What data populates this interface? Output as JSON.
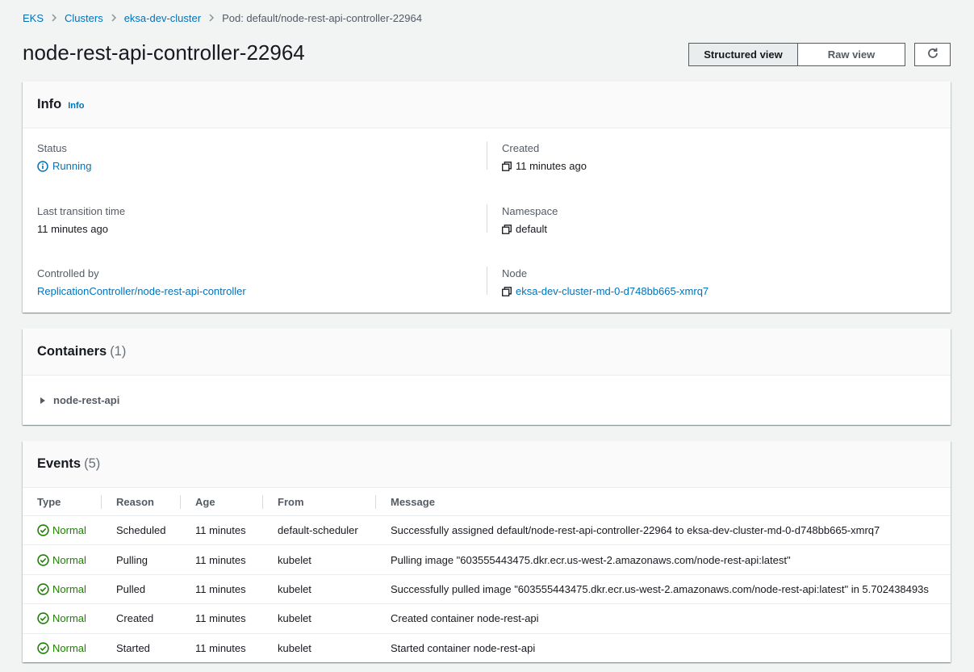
{
  "breadcrumb": {
    "items": [
      "EKS",
      "Clusters",
      "eksa-dev-cluster"
    ],
    "current": "Pod: default/node-rest-api-controller-22964"
  },
  "header": {
    "title": "node-rest-api-controller-22964",
    "structured_view": "Structured view",
    "raw_view": "Raw view",
    "refresh_icon": "refresh-icon"
  },
  "info": {
    "title": "Info",
    "info_link": "Info",
    "status_label": "Status",
    "status_value": "Running",
    "created_label": "Created",
    "created_value": "11 minutes ago",
    "last_transition_label": "Last transition time",
    "last_transition_value": "11 minutes ago",
    "namespace_label": "Namespace",
    "namespace_value": "default",
    "controlled_by_label": "Controlled by",
    "controlled_by_value": "ReplicationController/node-rest-api-controller",
    "node_label": "Node",
    "node_value": "eksa-dev-cluster-md-0-d748bb665-xmrq7"
  },
  "containers": {
    "title": "Containers",
    "count": "(1)",
    "items": [
      "node-rest-api"
    ]
  },
  "events": {
    "title": "Events",
    "count": "(5)",
    "columns": [
      "Type",
      "Reason",
      "Age",
      "From",
      "Message"
    ],
    "rows": [
      {
        "type": "Normal",
        "reason": "Scheduled",
        "age": "11 minutes",
        "from": "default-scheduler",
        "message": "Successfully assigned default/node-rest-api-controller-22964 to eksa-dev-cluster-md-0-d748bb665-xmrq7"
      },
      {
        "type": "Normal",
        "reason": "Pulling",
        "age": "11 minutes",
        "from": "kubelet",
        "message": "Pulling image \"603555443475.dkr.ecr.us-west-2.amazonaws.com/node-rest-api:latest\""
      },
      {
        "type": "Normal",
        "reason": "Pulled",
        "age": "11 minutes",
        "from": "kubelet",
        "message": "Successfully pulled image \"603555443475.dkr.ecr.us-west-2.amazonaws.com/node-rest-api:latest\" in 5.702438493s"
      },
      {
        "type": "Normal",
        "reason": "Created",
        "age": "11 minutes",
        "from": "kubelet",
        "message": "Created container node-rest-api"
      },
      {
        "type": "Normal",
        "reason": "Started",
        "age": "11 minutes",
        "from": "kubelet",
        "message": "Started container node-rest-api"
      }
    ]
  },
  "colors": {
    "link": "#0073bb",
    "success": "#1d8102",
    "background": "#f2f3f3"
  }
}
